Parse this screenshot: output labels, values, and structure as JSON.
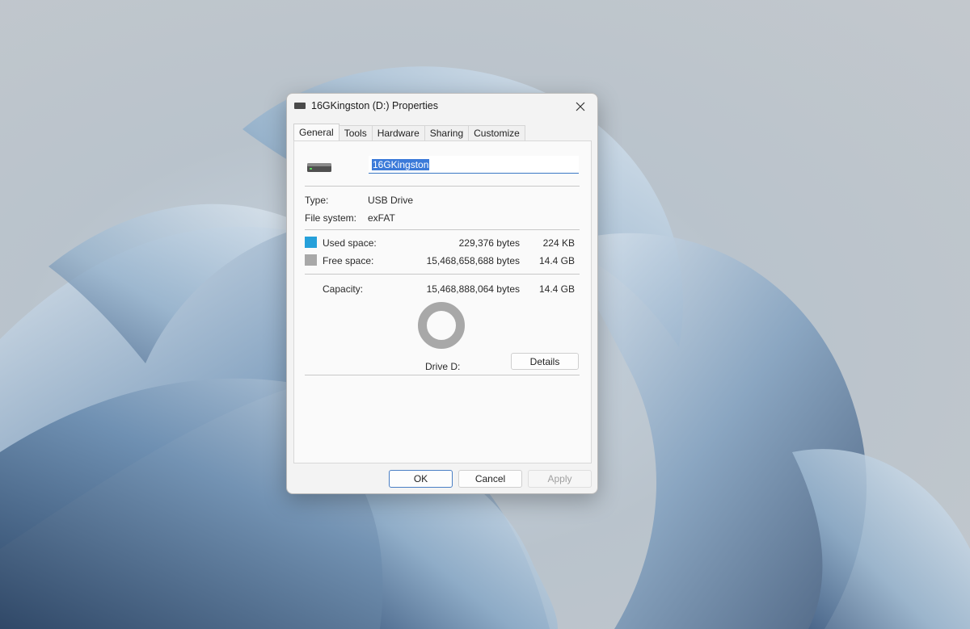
{
  "dialog": {
    "title": "16GKingston (D:) Properties",
    "tabs": [
      "General",
      "Tools",
      "Hardware",
      "Sharing",
      "Customize"
    ],
    "active_tab": "General"
  },
  "general": {
    "volume_name": "16GKingston",
    "type_label": "Type:",
    "type_value": "USB Drive",
    "fs_label": "File system:",
    "fs_value": "exFAT",
    "used_label": "Used space:",
    "used_bytes": "229,376 bytes",
    "used_size": "224 KB",
    "free_label": "Free space:",
    "free_bytes": "15,468,658,688 bytes",
    "free_size": "14.4 GB",
    "capacity_label": "Capacity:",
    "capacity_bytes": "15,468,888,064 bytes",
    "capacity_size": "14.4 GB",
    "drive_label": "Drive D:",
    "details_label": "Details",
    "used_fraction": 1.48e-05
  },
  "buttons": {
    "ok": "OK",
    "cancel": "Cancel",
    "apply": "Apply"
  },
  "colors": {
    "used": "#26a0da",
    "free": "#a8a8a8"
  }
}
